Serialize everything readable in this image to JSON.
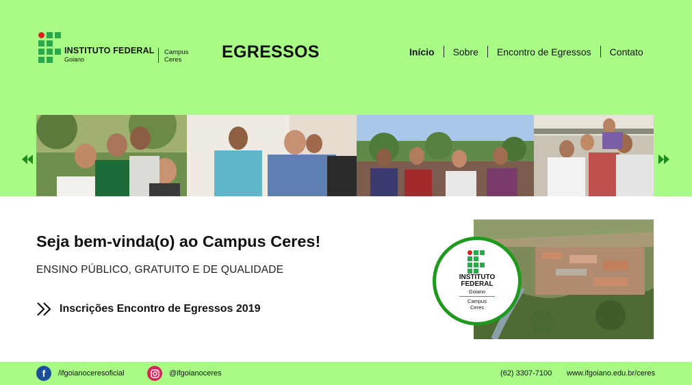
{
  "header": {
    "logo": {
      "institution": "INSTITUTO FEDERAL",
      "state": "Goiano",
      "campus_line1": "Campus",
      "campus_line2": "Ceres"
    },
    "title": "EGRESSOS",
    "nav": [
      {
        "label": "Início",
        "active": true
      },
      {
        "label": "Sobre",
        "active": false
      },
      {
        "label": "Encontro de Egressos",
        "active": false
      },
      {
        "label": "Contato",
        "active": false
      }
    ]
  },
  "carousel": {
    "prev_icon": "arrow-left-icon",
    "next_icon": "arrow-right-icon",
    "photos": [
      "group-photo-1",
      "group-photo-2",
      "group-photo-3",
      "group-photo-4"
    ]
  },
  "main": {
    "welcome": "Seja bem-vinda(o) ao Campus Ceres!",
    "subtitle": "ENSINO PÚBLICO, GRATUITO E DE QUALIDADE",
    "registration_link": "Inscrições Encontro de Egressos 2019",
    "badge": {
      "line1": "INSTITUTO",
      "line2": "FEDERAL",
      "state": "Goiano",
      "campus_line1": "Campus",
      "campus_line2": "Ceres"
    }
  },
  "footer": {
    "facebook": "/ifgoianoceresoficial",
    "instagram": "@ifgoianoceres",
    "phone": "(62) 3307-7100",
    "website": "www.ifgoiano.edu.br/ceres"
  },
  "colors": {
    "header_bg": "#a8fb85",
    "brand_green": "#2aa84a",
    "brand_red": "#e02020",
    "badge_ring": "#1f9a1f"
  }
}
